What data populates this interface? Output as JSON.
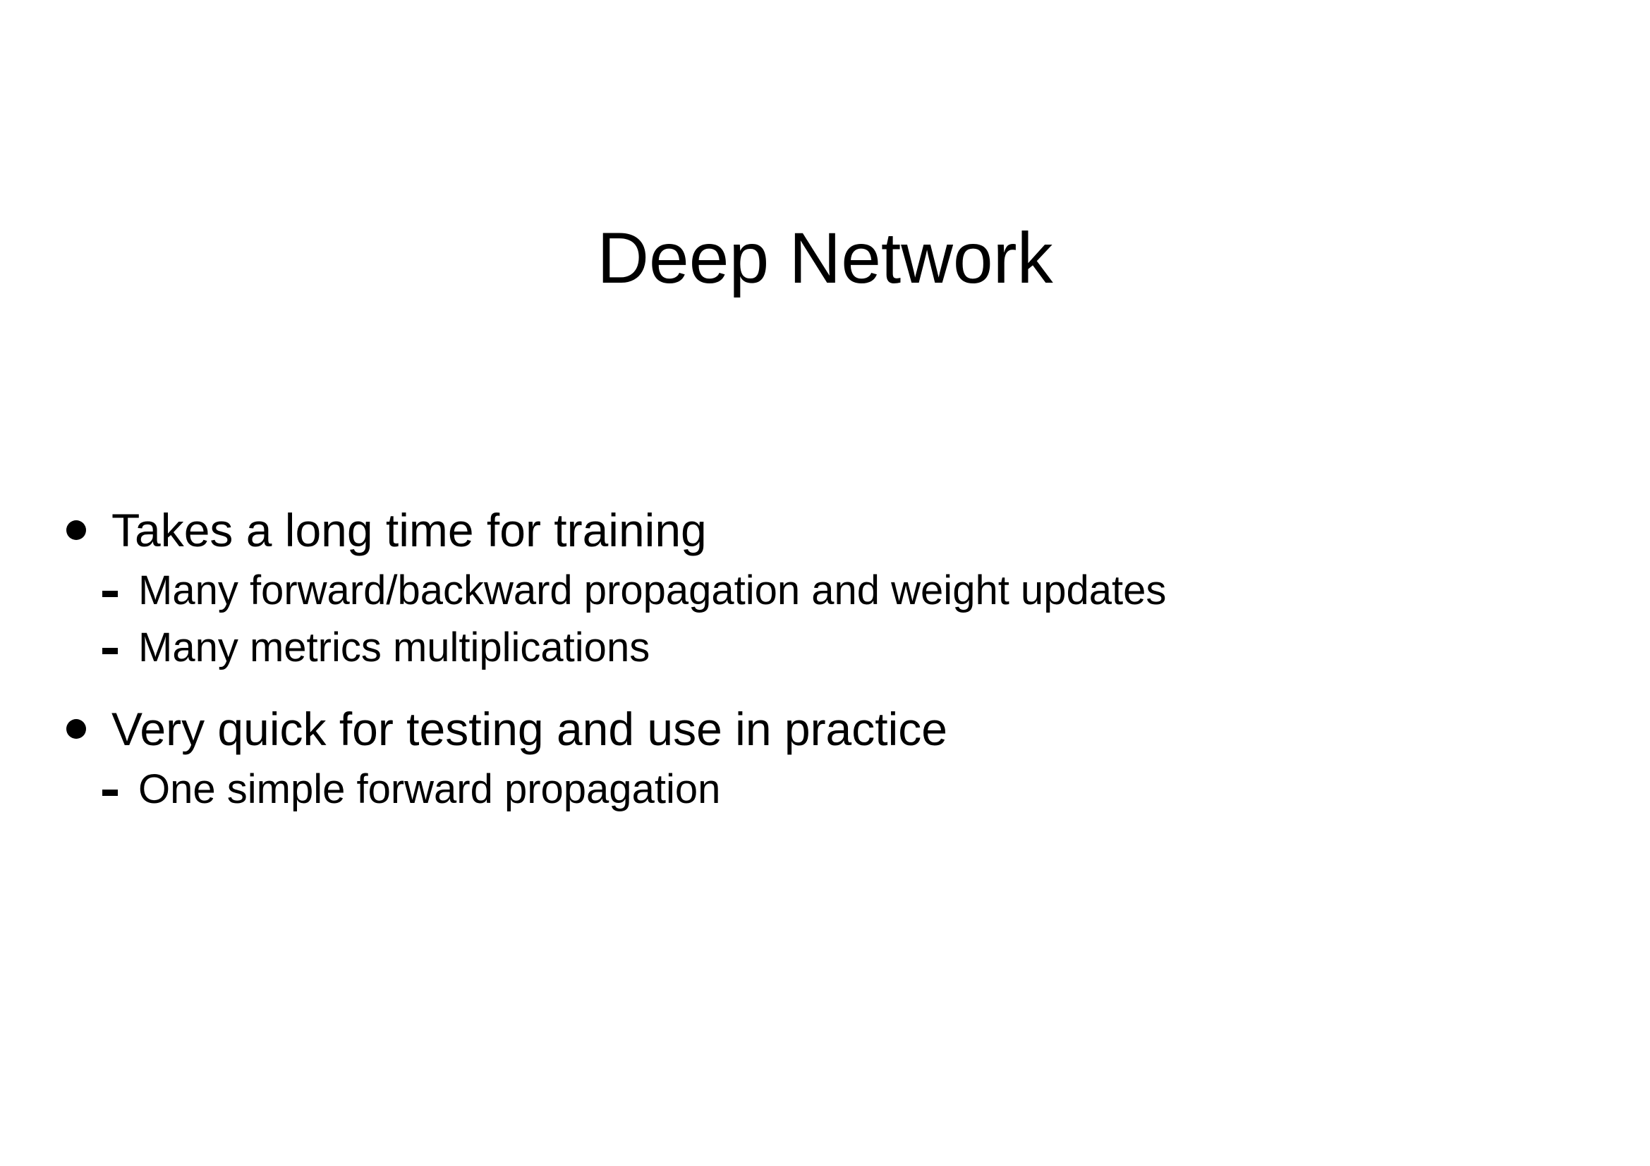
{
  "slide": {
    "title": "Deep Network",
    "bullets": [
      {
        "text": "Takes a long time for training",
        "subitems": [
          "Many forward/backward propagation and weight updates",
          "Many metrics multiplications"
        ]
      },
      {
        "text": "Very quick for testing and use in practice",
        "subitems": [
          "One simple forward propagation"
        ]
      }
    ]
  },
  "colors": {
    "background": "#ffffff",
    "text": "#000000"
  }
}
